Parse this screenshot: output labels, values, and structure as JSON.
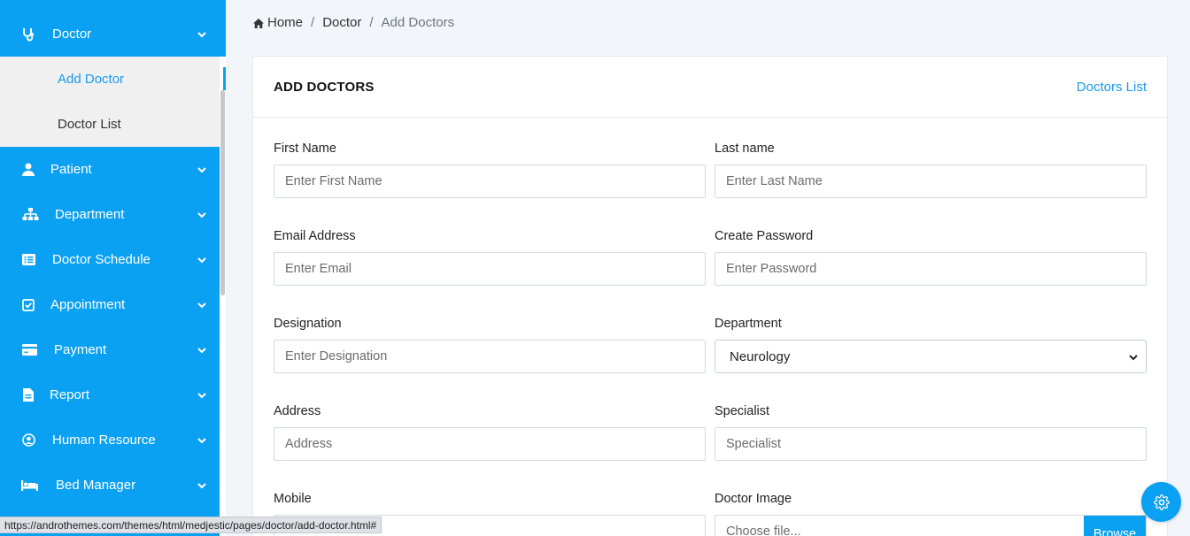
{
  "colors": {
    "primary": "#0aa1f3",
    "link": "#1a9af0",
    "page_bg": "#f2f5fa"
  },
  "sidebar": {
    "items": [
      {
        "label": "Doctor",
        "icon": "stethoscope-icon",
        "expanded": true
      },
      {
        "label": "Patient",
        "icon": "user-icon"
      },
      {
        "label": "Department",
        "icon": "sitemap-icon"
      },
      {
        "label": "Doctor Schedule",
        "icon": "list-icon"
      },
      {
        "label": "Appointment",
        "icon": "check-square-icon"
      },
      {
        "label": "Payment",
        "icon": "credit-card-icon"
      },
      {
        "label": "Report",
        "icon": "file-icon"
      },
      {
        "label": "Human Resource",
        "icon": "user-circle-icon"
      },
      {
        "label": "Bed Manager",
        "icon": "bed-icon"
      }
    ],
    "doctor_submenu": [
      {
        "label": "Add Doctor",
        "active": true
      },
      {
        "label": "Doctor List"
      }
    ]
  },
  "breadcrumb": {
    "home": "Home",
    "parent": "Doctor",
    "current": "Add Doctors",
    "separator": "/"
  },
  "card": {
    "title": "ADD DOCTORS",
    "link": "Doctors List",
    "fields": {
      "first_name": {
        "label": "First Name",
        "placeholder": "Enter First Name"
      },
      "last_name": {
        "label": "Last name",
        "placeholder": "Enter Last Name"
      },
      "email": {
        "label": "Email Address",
        "placeholder": "Enter Email"
      },
      "password": {
        "label": "Create Password",
        "placeholder": "Enter Password"
      },
      "designation": {
        "label": "Designation",
        "placeholder": "Enter Designation"
      },
      "department": {
        "label": "Department",
        "value": "Neurology"
      },
      "address": {
        "label": "Address",
        "placeholder": "Address"
      },
      "specialist": {
        "label": "Specialist",
        "placeholder": "Specialist"
      },
      "mobile": {
        "label": "Mobile"
      },
      "doctor_image": {
        "label": "Doctor Image",
        "placeholder": "Choose file...",
        "button": "Browse"
      }
    }
  },
  "fab": {
    "icon": "gear-icon"
  },
  "statusbar": {
    "url": "https://androthemes.com/themes/html/medjestic/pages/doctor/add-doctor.html#"
  }
}
